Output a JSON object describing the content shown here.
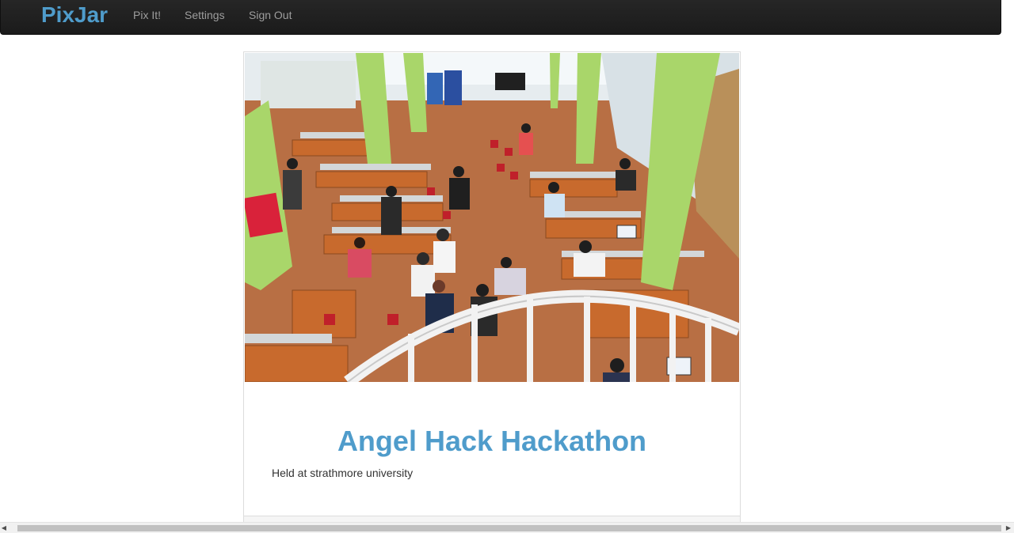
{
  "navbar": {
    "brand": "PixJar",
    "links": [
      {
        "label": "Pix It!"
      },
      {
        "label": "Settings"
      },
      {
        "label": "Sign Out"
      }
    ]
  },
  "post": {
    "title": "Angel Hack Hackathon",
    "description": "Held at strathmore university",
    "image_alt": "Overhead view of a crowded hackathon room with desks, laptops and green pillars"
  },
  "scrollbar": {
    "left_arrow_icon": "triangle-left",
    "right_arrow_icon": "triangle-right"
  },
  "colors": {
    "brand": "#4f9ccb",
    "navbar_bg": "#1f1f1f",
    "nav_link": "#9d9d9d",
    "text": "#333333"
  }
}
